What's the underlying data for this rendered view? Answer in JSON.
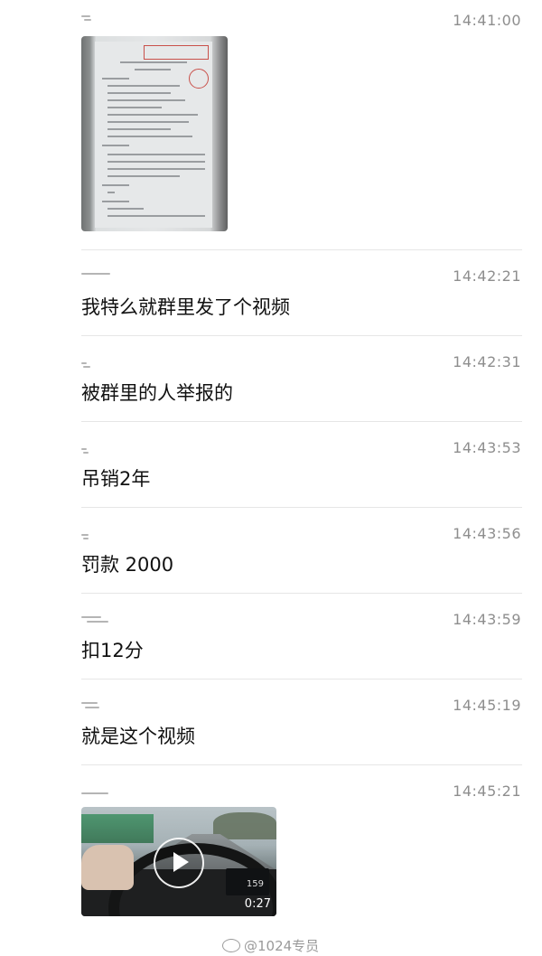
{
  "messages": [
    {
      "time": "14:41:00",
      "type": "image"
    },
    {
      "time": "14:42:21",
      "type": "text",
      "text": "我特么就群里发了个视频"
    },
    {
      "time": "14:42:31",
      "type": "text",
      "text": "被群里的人举报的"
    },
    {
      "time": "14:43:53",
      "type": "text",
      "text": "吊销2年"
    },
    {
      "time": "14:43:56",
      "type": "text",
      "text": "罚款 2000"
    },
    {
      "time": "14:43:59",
      "type": "text",
      "text": "扣12分"
    },
    {
      "time": "14:45:19",
      "type": "text",
      "text": "就是这个视频"
    },
    {
      "time": "14:45:21",
      "type": "video",
      "duration": "0:27",
      "dash_reading": "159"
    }
  ],
  "watermark": "@1024专员"
}
